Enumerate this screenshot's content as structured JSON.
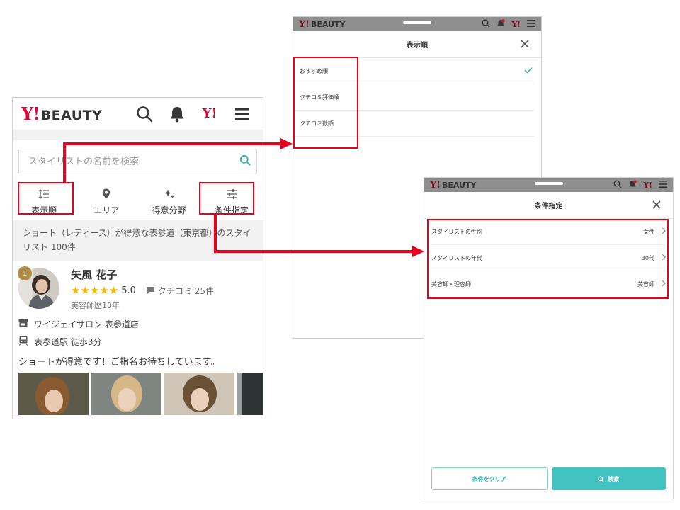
{
  "main": {
    "logo_y": "Y!",
    "logo_text": "BEAUTY",
    "header_icons": [
      "search-icon",
      "bell-icon",
      "yahoo-icon",
      "menu-icon"
    ],
    "yahoo_mark": "Y!",
    "search_placeholder": "スタイリストの名前を検索",
    "tabs": [
      {
        "label": "表示順",
        "icon": "sort-icon"
      },
      {
        "label": "エリア",
        "icon": "pin-icon"
      },
      {
        "label": "得意分野",
        "icon": "sparkle-icon"
      },
      {
        "label": "条件指定",
        "icon": "filter-icon"
      }
    ],
    "result_text": "ショート（レディース）が得意な表参道（東京都）のスタイリスト 100件",
    "stylist": {
      "rank": "1",
      "name": "矢風 花子",
      "stars": "★★★★★",
      "rating": "5.0",
      "reviews": "クチコミ 25件",
      "career": "美容師歴10年",
      "salon": "ワイジェイサロン 表参道店",
      "access": "表参道駅 徒歩3分",
      "comment": "ショートが得意です！ご指名お待ちしています。"
    }
  },
  "sort_sheet": {
    "logo_y": "Y!",
    "logo_text": "BEAUTY",
    "title": "表示順",
    "options": [
      {
        "label": "おすすめ順",
        "selected": true
      },
      {
        "label": "クチコミ評価順",
        "selected": false
      },
      {
        "label": "クチコミ数順",
        "selected": false
      }
    ]
  },
  "filter_sheet": {
    "logo_y": "Y!",
    "logo_text": "BEAUTY",
    "title": "条件指定",
    "rows": [
      {
        "label": "スタイリストの性別",
        "value": "女性"
      },
      {
        "label": "スタイリストの年代",
        "value": "30代"
      },
      {
        "label": "美容師・理容師",
        "value": "美容師"
      }
    ],
    "clear_label": "条件をクリア",
    "search_label": "検索"
  },
  "colors": {
    "brand_red": "#e60033",
    "accent_teal": "#42c3c1",
    "highlight_red": "#e8001c",
    "star_gold": "#f1b800"
  }
}
